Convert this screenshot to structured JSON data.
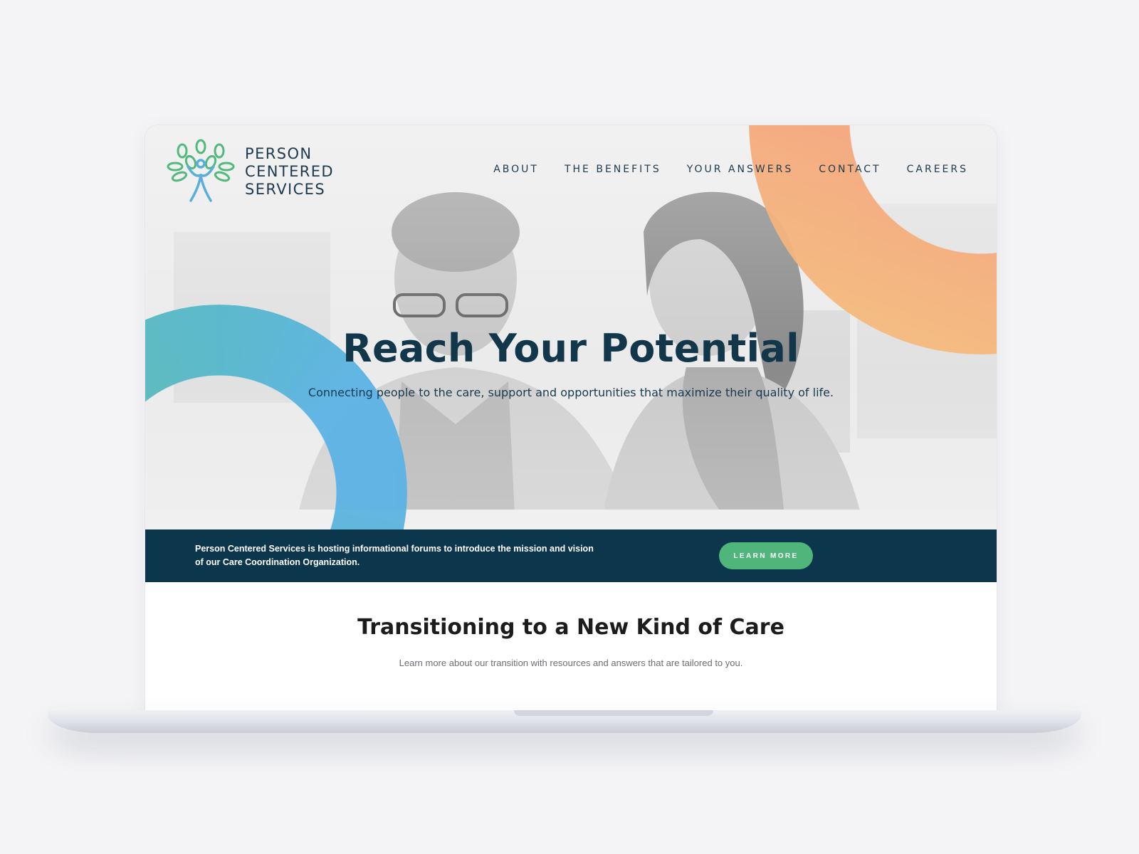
{
  "brand": {
    "line1": "PERSON",
    "line2": "CENTERED",
    "line3": "SERVICES",
    "colors": {
      "navy": "#0c364b",
      "green": "#4fb57a",
      "coral": "#f38a7c",
      "teal": "#5cb3e6"
    }
  },
  "nav": {
    "items": [
      "ABOUT",
      "THE BENEFITS",
      "YOUR ANSWERS",
      "CONTACT",
      "CAREERS"
    ]
  },
  "hero": {
    "title": "Reach Your Potential",
    "subtitle": "Connecting people to the care, support and opportunities that maximize their quality of life."
  },
  "banner": {
    "text": "Person Centered Services is hosting informational forums to introduce the mission and vision of our Care Coordination Organization.",
    "button_label": "LEARN MORE"
  },
  "section": {
    "title": "Transitioning to a New Kind of Care",
    "subtitle": "Learn more about our transition with resources and answers that are tailored to you."
  },
  "icons": [
    "tree-person-logo-icon"
  ]
}
